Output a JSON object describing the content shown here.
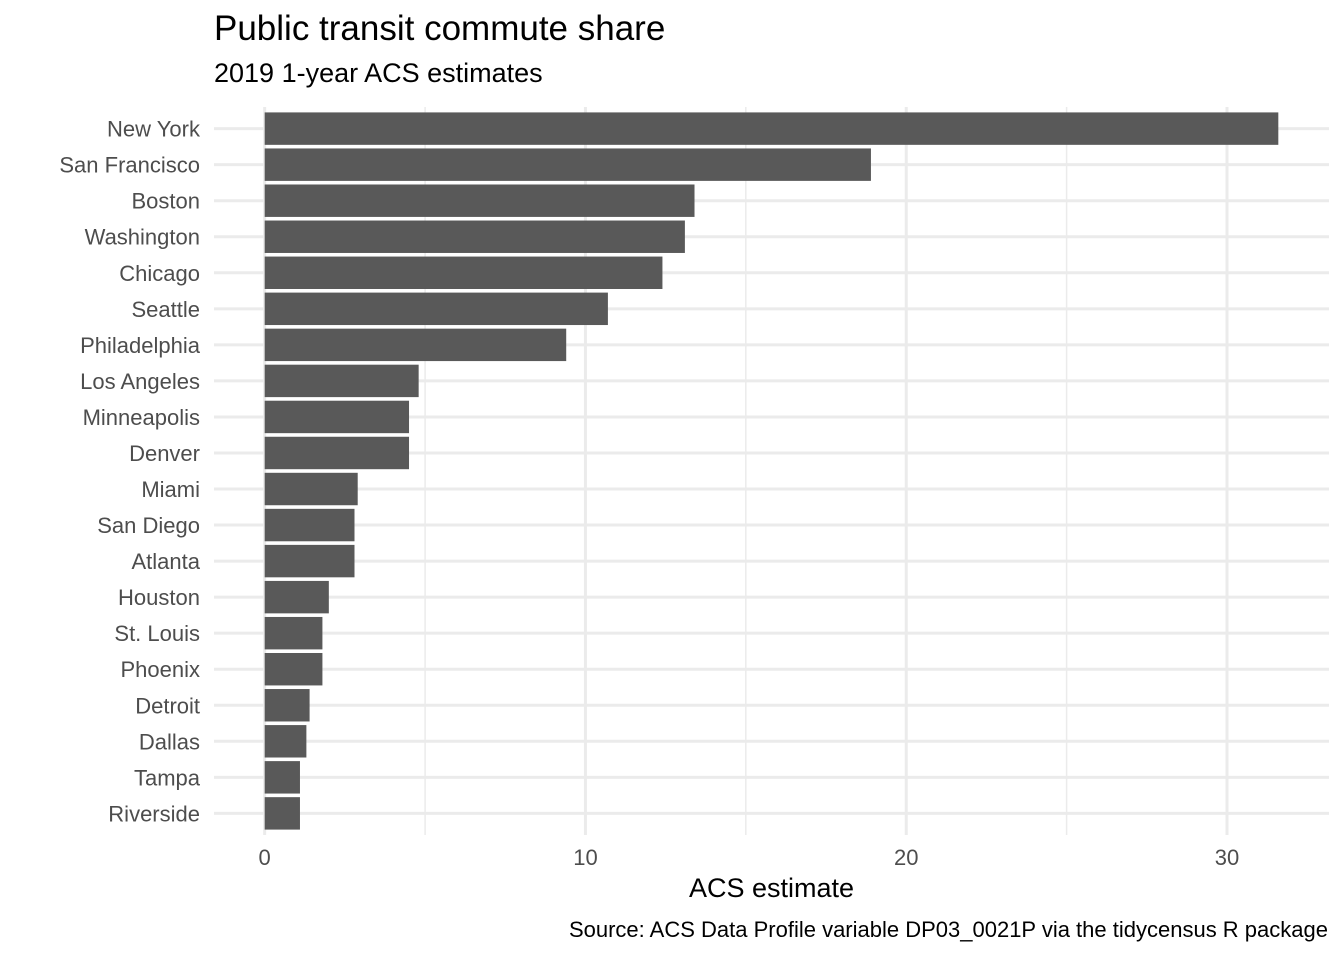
{
  "chart_data": {
    "type": "bar",
    "orientation": "horizontal",
    "title": "Public transit commute share",
    "subtitle": "2019 1-year ACS estimates",
    "xlabel": "ACS estimate",
    "ylabel": "",
    "caption": "Source: ACS Data Profile variable DP03_0021P via the tidycensus R package",
    "categories": [
      "New York",
      "San Francisco",
      "Boston",
      "Washington",
      "Chicago",
      "Seattle",
      "Philadelphia",
      "Los Angeles",
      "Minneapolis",
      "Denver",
      "Miami",
      "San Diego",
      "Atlanta",
      "Houston",
      "St. Louis",
      "Phoenix",
      "Detroit",
      "Dallas",
      "Tampa",
      "Riverside"
    ],
    "values": [
      31.6,
      18.9,
      13.4,
      13.1,
      12.4,
      10.7,
      9.4,
      4.8,
      4.5,
      4.5,
      2.9,
      2.8,
      2.8,
      2.0,
      1.8,
      1.8,
      1.4,
      1.3,
      1.1,
      1.1
    ],
    "xlim": [
      -1.58,
      33.18
    ],
    "xticks": [
      0,
      10,
      20,
      30
    ],
    "xtick_labels": [
      "0",
      "10",
      "20",
      "30"
    ],
    "grid": true,
    "legend": "none",
    "bar_color": "#595959",
    "grid_color": "#ebebeb"
  }
}
